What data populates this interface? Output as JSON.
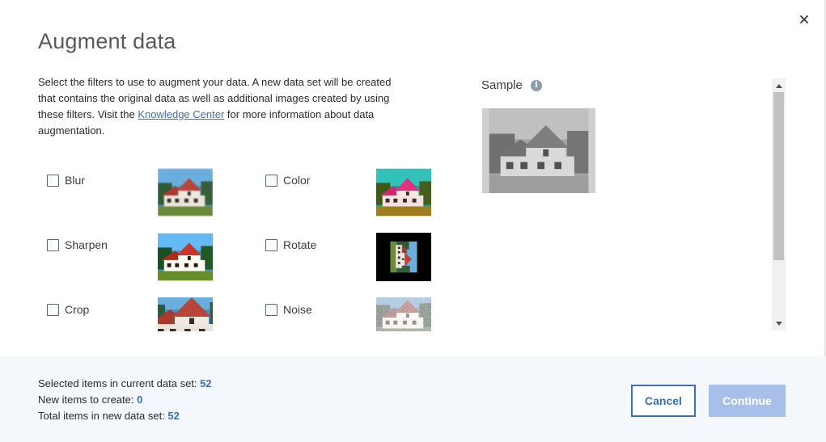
{
  "dialog": {
    "title": "Augment data",
    "description_before": "Select the filters to use to augment your data. A new data set will be created that contains the original data as well as additional images created by using these filters. Visit the ",
    "link_text": "Knowledge Center",
    "description_after": " for more information about data augmentation.",
    "close_icon": "close-icon"
  },
  "filters": [
    {
      "label": "Blur",
      "checked": false
    },
    {
      "label": "Color",
      "checked": false
    },
    {
      "label": "Sharpen",
      "checked": false
    },
    {
      "label": "Rotate",
      "checked": false
    },
    {
      "label": "Crop",
      "checked": false
    },
    {
      "label": "Noise",
      "checked": false
    }
  ],
  "sample": {
    "title": "Sample",
    "info_icon": "info-icon",
    "info_glyph": "i"
  },
  "footer": {
    "selected_label": "Selected items in current data set: ",
    "selected_value": "52",
    "new_label": "New items to create: ",
    "new_value": "0",
    "total_label": "Total items in new data set: ",
    "total_value": "52",
    "cancel_label": "Cancel",
    "continue_label": "Continue"
  },
  "colors": {
    "accent": "#3d70b2",
    "continue_disabled": "#a6c0ea",
    "footer_bg": "#f4f7fb"
  }
}
